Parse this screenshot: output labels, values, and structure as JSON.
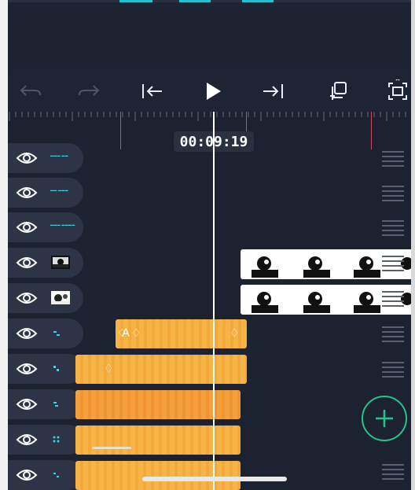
{
  "timecode": "00:09:19",
  "toolbar": {
    "undo": "undo-icon",
    "redo": "redo-icon",
    "jump_start": "jump-to-start-icon",
    "play": "play-icon",
    "jump_end": "jump-to-end-icon",
    "copy": "copy-icon",
    "fit": "fit-to-screen-icon"
  },
  "tracks": [
    {
      "kind": "text",
      "label": "▬▬▬ ▬▬"
    },
    {
      "kind": "text",
      "label": "▬▬ ▬▬▬"
    },
    {
      "kind": "text",
      "label": "▬▬▬ ▬▬▬▬"
    },
    {
      "kind": "image"
    },
    {
      "kind": "image"
    },
    {
      "kind": "effect",
      "clip_label": "A"
    },
    {
      "kind": "effect"
    },
    {
      "kind": "effect"
    },
    {
      "kind": "effect"
    },
    {
      "kind": "effect"
    }
  ],
  "fab_icon": "plus-icon",
  "colors": {
    "accent_orange": "#f6b348",
    "accent_green": "#21c78a",
    "marker_red": "#d2495e",
    "label_cyan": "#3fd3de"
  }
}
